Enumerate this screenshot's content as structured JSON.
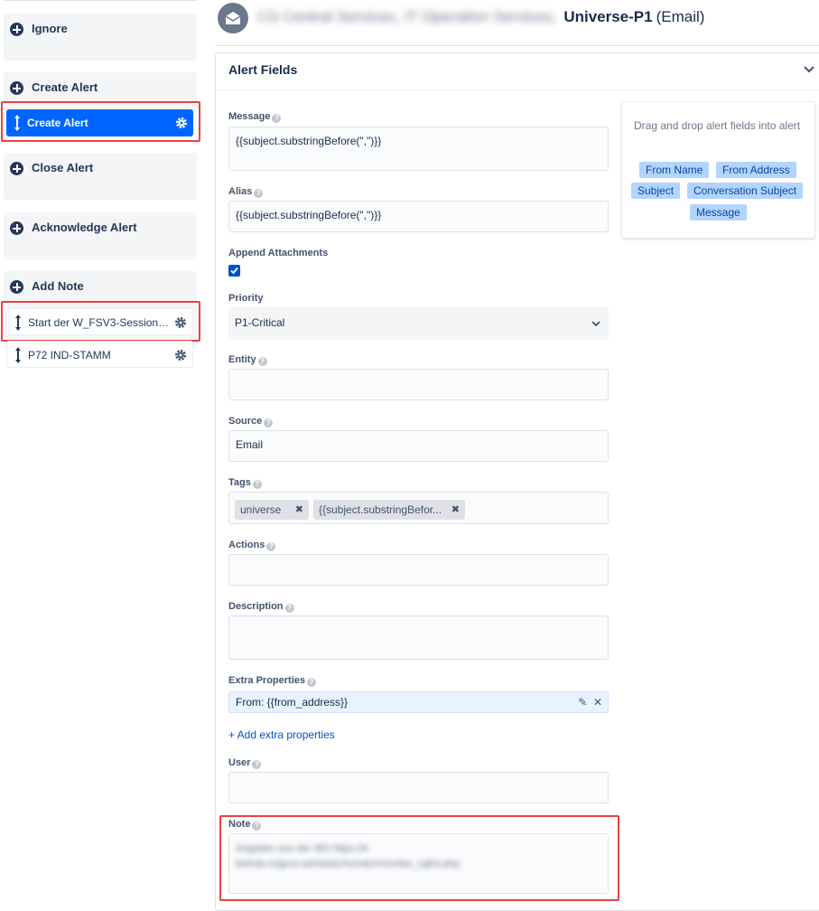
{
  "sidebar": {
    "action_cards": [
      {
        "label": "Ignore"
      },
      {
        "label": "Create Alert"
      },
      {
        "label": "Close Alert"
      },
      {
        "label": "Acknowledge Alert"
      },
      {
        "label": "Add Note"
      }
    ],
    "rules": [
      {
        "label": "Create Alert",
        "state": "active"
      },
      {
        "label": "Start der W_FSV3-Session g..."
      },
      {
        "label": "P72 IND-STAMM"
      }
    ]
  },
  "header": {
    "blurred_path": "CS Central Services, IT Operation Services,",
    "integration_name": "Universe-P1",
    "integration_type": "(Email)",
    "icon": "email-icon"
  },
  "panel": {
    "title": "Alert Fields",
    "fields": {
      "message": {
        "label": "Message",
        "value": "{{subject.substringBefore(\",\")}}"
      },
      "alias": {
        "label": "Alias",
        "value": "{{subject.substringBefore(\",\")}}"
      },
      "append_attachments": {
        "label": "Append Attachments",
        "checked": true
      },
      "priority": {
        "label": "Priority",
        "value": "P1-Critical"
      },
      "entity": {
        "label": "Entity",
        "value": ""
      },
      "source": {
        "label": "Source",
        "value": "Email"
      },
      "tags": {
        "label": "Tags",
        "chips": [
          "universe",
          "{{subject.substringBefor..."
        ]
      },
      "actions": {
        "label": "Actions",
        "value": ""
      },
      "description": {
        "label": "Description",
        "value": ""
      },
      "extra_properties": {
        "label": "Extra Properties",
        "entry": "From: {{from_address}}",
        "add_label": "+ Add extra properties"
      },
      "user": {
        "label": "User",
        "value": ""
      },
      "note": {
        "label": "Note",
        "line1": "Angaben aus der IBS https://e",
        "line2": "belnde.migros.net/static/monitor/monitor_ngfra.php"
      }
    }
  },
  "dnd_helper": {
    "text": "Drag and drop alert fields into alert",
    "chips": [
      "From Name",
      "From Address",
      "Subject",
      "Conversation Subject",
      "Message"
    ]
  },
  "colors": {
    "accent": "#0065ff",
    "highlight_box": "#e34444",
    "chip": "#b3d4ff"
  }
}
